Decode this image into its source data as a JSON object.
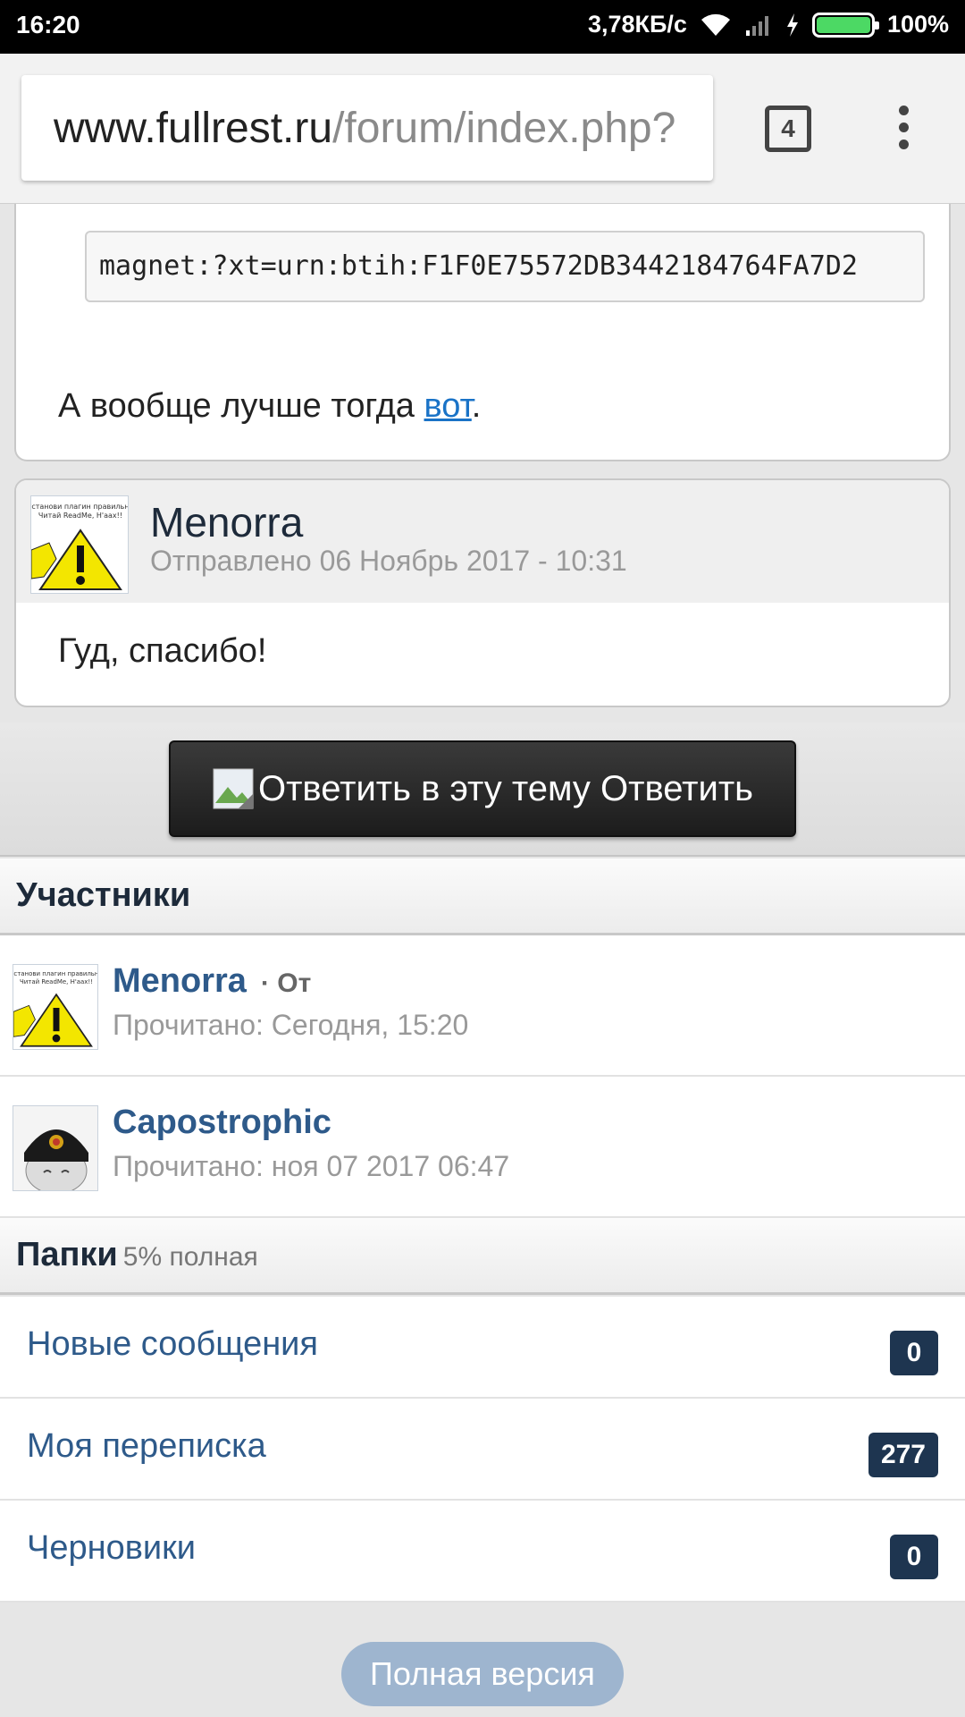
{
  "statusbar": {
    "time": "16:20",
    "speed": "3,78КБ/с",
    "battery": "100%",
    "battery_level": 1.0
  },
  "browser": {
    "url_host": "www.fullrest.ru",
    "url_path": "/forum/index.php?",
    "tab_count": "4"
  },
  "previous_post": {
    "magnet": "magnet:?xt=urn:btih:F1F0E75572DB3442184764FA7D2",
    "text_before_link": "А вообще лучше тогда ",
    "link_text": "вот",
    "text_after_link": "."
  },
  "post": {
    "avatar_caption_1": "установи плагин правильно",
    "avatar_caption_2": "Читай ReadMe, H'aax!!",
    "author": "Menorra",
    "date": "Отправлено 06 Ноябрь 2017 - 10:31",
    "body": "Гуд, спасибо!"
  },
  "reply": {
    "label": "Ответить в эту тему Ответить"
  },
  "participants": {
    "title": "Участники",
    "members": [
      {
        "name": "Menorra",
        "status": "· От",
        "read": "Прочитано: Сегодня, 15:20"
      },
      {
        "name": "Capostrophic",
        "status": "",
        "read": "Прочитано: ноя 07 2017 06:47"
      }
    ]
  },
  "folders": {
    "title": "Папки",
    "usage": "5% полная",
    "items": [
      {
        "label": "Новые сообщения",
        "count": "0"
      },
      {
        "label": "Моя переписка",
        "count": "277"
      },
      {
        "label": "Черновики",
        "count": "0"
      }
    ]
  },
  "footer": {
    "full_version": "Полная версия"
  }
}
